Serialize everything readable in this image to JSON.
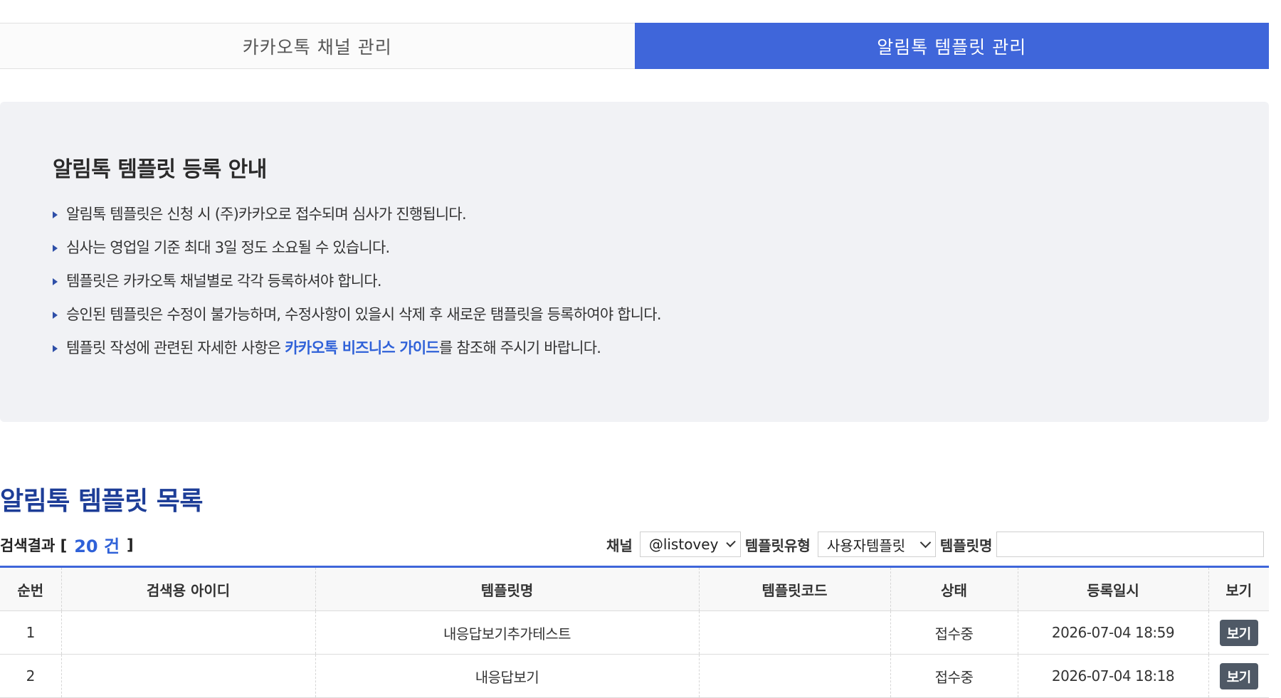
{
  "tabs": [
    {
      "label": "카카오톡 채널 관리",
      "active": false
    },
    {
      "label": "알림톡 템플릿 관리",
      "active": true
    }
  ],
  "guide": {
    "title": "알림톡 템플릿 등록 안내",
    "items": [
      "알림톡 템플릿은 신청 시 (주)카카오로 접수되며 심사가 진행됩니다.",
      "심사는 영업일 기준 최대 3일 정도 소요될 수 있습니다.",
      "템플릿은 카카오톡 채널별로 각각 등록하셔야 합니다.",
      "승인된 템플릿은 수정이 불가능하며, 수정사항이 있을시 삭제 후 새로운 탬플릿을 등록하여야 합니다."
    ],
    "last_item": {
      "before": "템플릿 작성에 관련된 자세한 사항은 ",
      "link": "카카오톡 비즈니스 가이드",
      "after": "를 참조해 주시기 바랍니다."
    }
  },
  "list": {
    "title": "알림톡 템플릿 목록",
    "result_prefix": "검색결과 [",
    "result_count": "20 건",
    "result_suffix": "]"
  },
  "filters": {
    "channel_label": "채널",
    "channel_value": "@listovey",
    "type_label": "템플릿유형",
    "type_value": "사용자템플릿",
    "name_label": "템플릿명",
    "name_value": ""
  },
  "table": {
    "headers": [
      "순번",
      "검색용 아이디",
      "템플릿명",
      "템플릿코드",
      "상태",
      "등록일시",
      "보기"
    ],
    "rows": [
      {
        "no": "1",
        "search_id": "",
        "name": "내응답보기추가테스트",
        "code": "",
        "status": "접수중",
        "date": "2026-07-04 18:59",
        "action": "보기"
      },
      {
        "no": "2",
        "search_id": "",
        "name": "내응답보기",
        "code": "",
        "status": "접수중",
        "date": "2026-07-04 18:18",
        "action": "보기"
      }
    ]
  },
  "colors": {
    "accent": "#3f66da",
    "link": "#2f61d8",
    "title_navy": "#1d3d97",
    "guide_bg": "#f1f2f5",
    "view_button": "#4f5966"
  }
}
